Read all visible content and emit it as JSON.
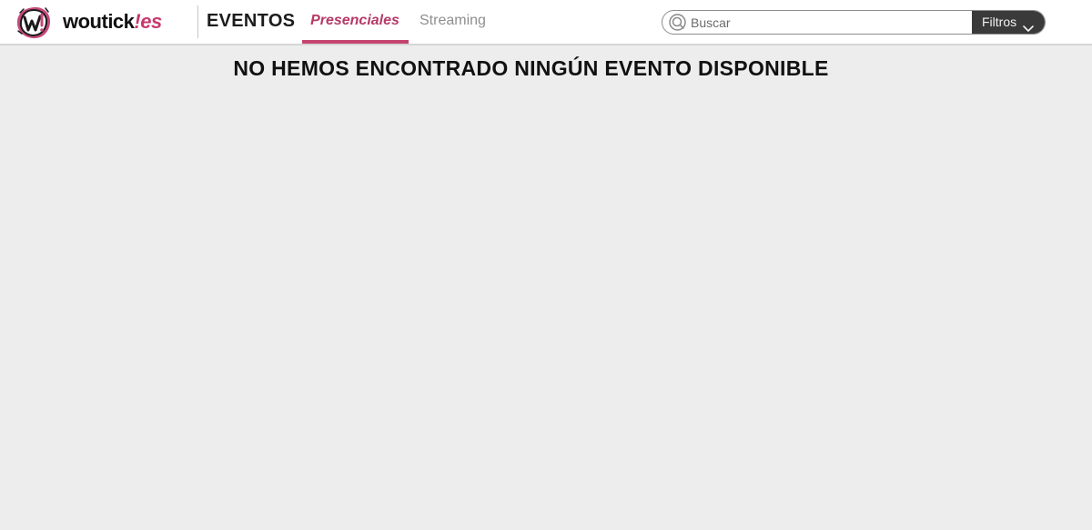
{
  "header": {
    "brand_name": "woutick",
    "brand_suffix": "!es",
    "section_title": "EVENTOS",
    "tabs": [
      {
        "label": "Presenciales",
        "active": true
      },
      {
        "label": "Streaming",
        "active": false
      }
    ],
    "search": {
      "placeholder": "Buscar",
      "value": ""
    },
    "filters_label": "Filtros"
  },
  "main": {
    "empty_message": "NO HEMOS ENCONTRADO NINGÚN EVENTO DISPONIBLE"
  },
  "colors": {
    "accent": "#c2446f",
    "active_tab_text": "#b63a66",
    "inactive_tab_text": "#8e8e8e",
    "page_background": "#ededed",
    "filters_background": "#3a3a3a"
  },
  "icons": {
    "logo": "woutick-logo-icon",
    "search": "search-icon",
    "filters_chevron": "chevron-down-icon"
  }
}
